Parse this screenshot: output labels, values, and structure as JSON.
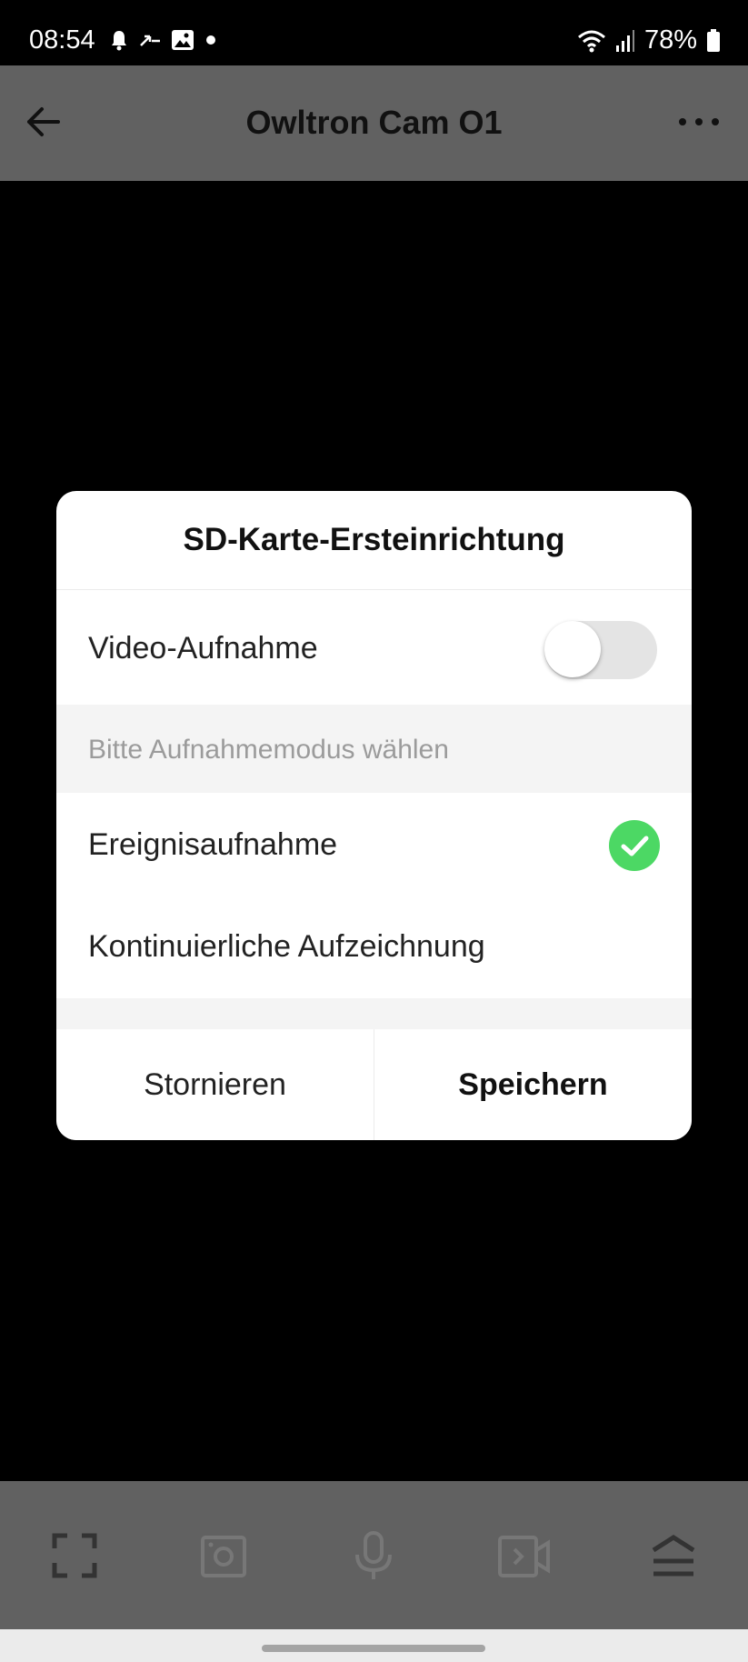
{
  "status_bar": {
    "time": "08:54",
    "battery": "78%",
    "icons": [
      "notification-bell-icon",
      "call-forward-icon",
      "gallery-icon",
      "dot-icon",
      "wifi-icon",
      "signal-icon",
      "battery-icon"
    ]
  },
  "header": {
    "title": "Owltron Cam O1",
    "back_icon": "arrow-left-icon",
    "menu_icon": "more-dots-icon"
  },
  "dialog": {
    "title": "SD-Karte-Ersteinrichtung",
    "video_recording": {
      "label": "Video-Aufnahme",
      "enabled": false
    },
    "section_hint": "Bitte Aufnahmemodus wählen",
    "modes": [
      {
        "label": "Ereignisaufnahme",
        "selected": true
      },
      {
        "label": "Kontinuierliche Aufzeichnung",
        "selected": false
      }
    ],
    "cancel_label": "Stornieren",
    "save_label": "Speichern"
  },
  "toolbar": {
    "icons": [
      "fullscreen-icon",
      "snapshot-icon",
      "microphone-icon",
      "record-video-icon",
      "more-options-icon"
    ]
  },
  "colors": {
    "accent_check": "#4cd864",
    "header_bg": "#616161"
  }
}
